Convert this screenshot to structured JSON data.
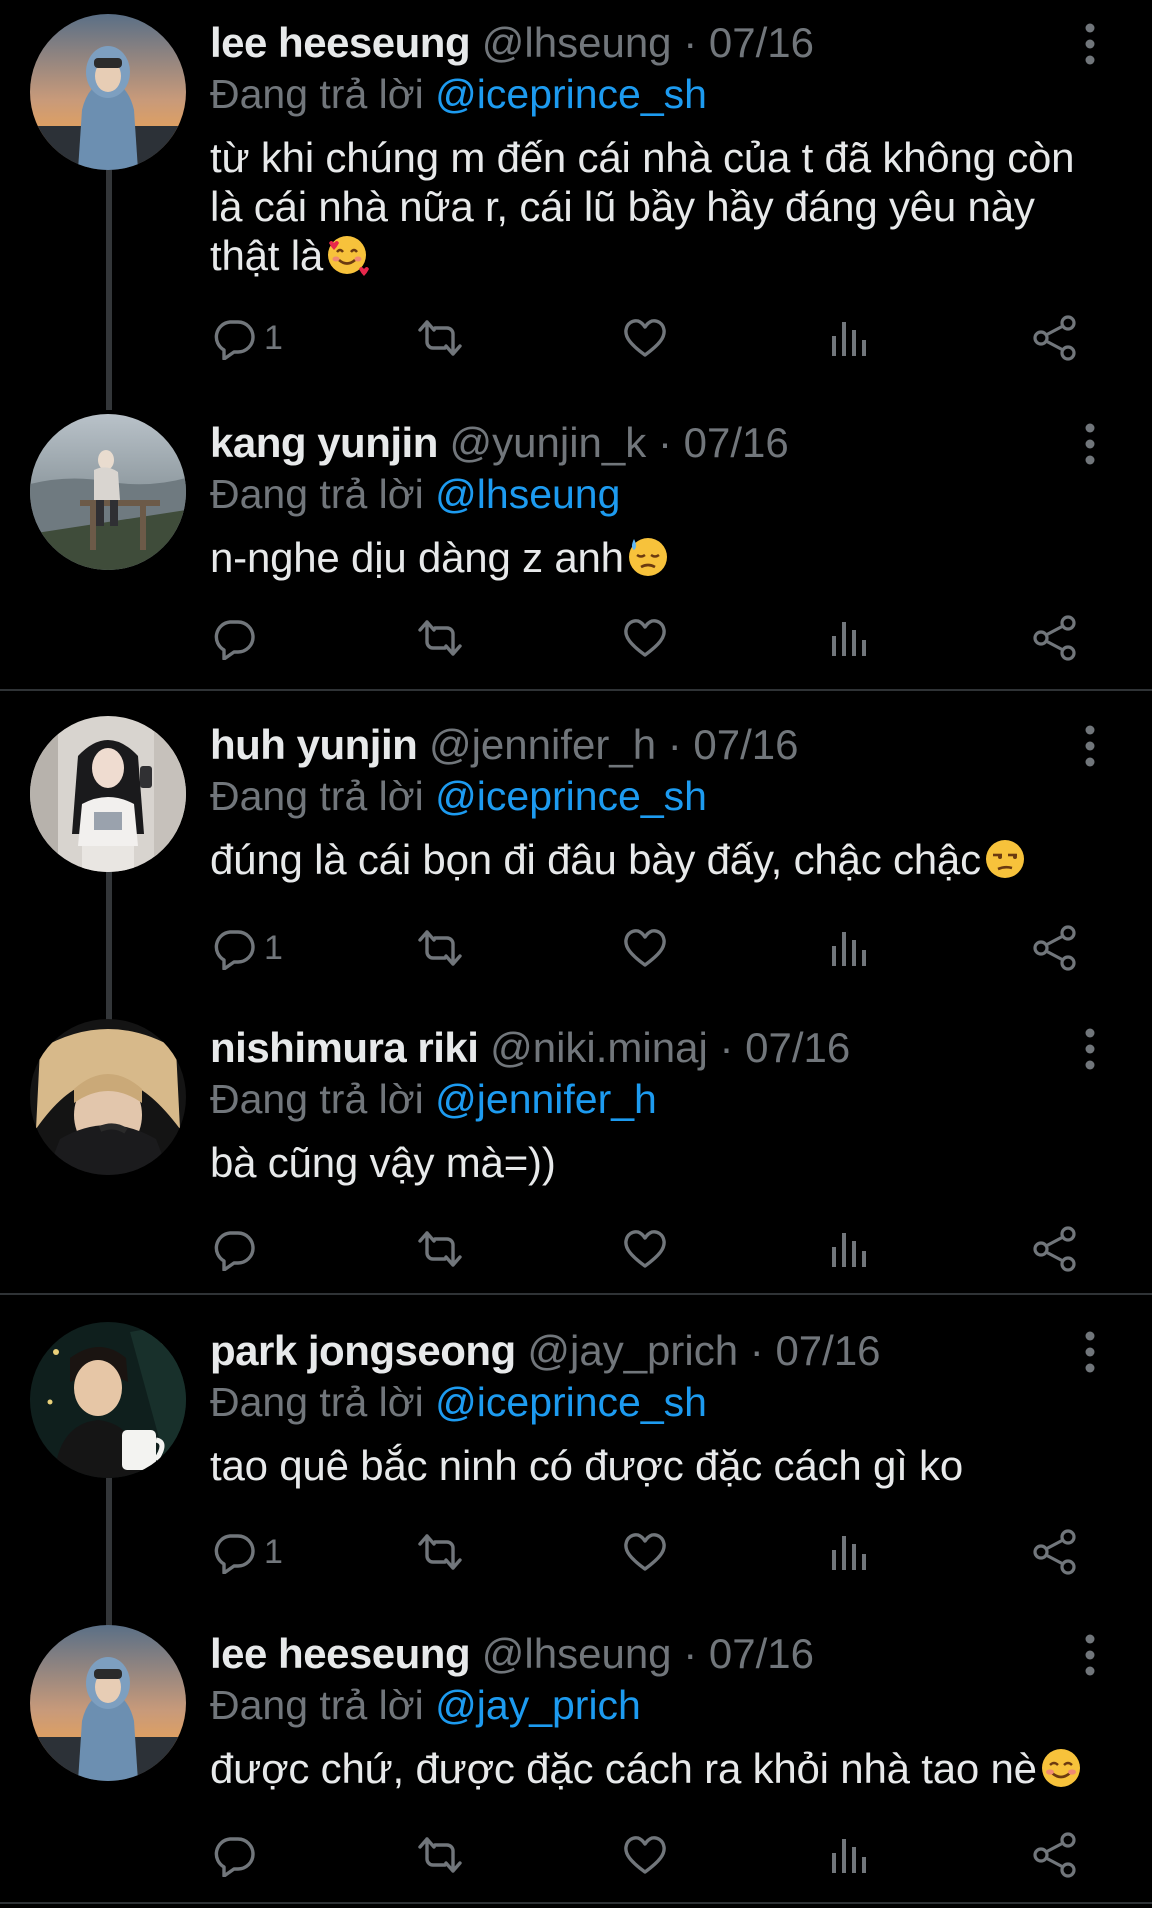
{
  "colors": {
    "background": "#000000",
    "text": "#e7e9ea",
    "muted": "#71767b",
    "mention": "#1d9bf0",
    "thread_line": "#333639",
    "divider": "#2f3336"
  },
  "reply_prefix": "Đang trả lời",
  "tweets": [
    {
      "display_name": "lee heeseung",
      "handle": "@lhseung",
      "dot": "·",
      "date": "07/16",
      "reply_to": "@iceprince_sh",
      "text": "từ khi chúng m đến cái nhà của t đã không còn là cái nhà nữa r, cái lũ bầy hầy đáng yêu này thật là",
      "emoji": "smiling-face-with-hearts",
      "reply_count": "1",
      "avatar": "hooded-person-blue-hoodie"
    },
    {
      "display_name": "kang yunjin",
      "handle": "@yunjin_k",
      "dot": "·",
      "date": "07/16",
      "reply_to": "@lhseung",
      "text": "n-nghe dịu dàng z anh",
      "emoji": "downcast-face-with-sweat",
      "reply_count": "",
      "avatar": "person-on-fence-by-sea"
    },
    {
      "display_name": "huh yunjin",
      "handle": "@jennifer_h",
      "dot": "·",
      "date": "07/16",
      "reply_to": "@iceprince_sh",
      "text": "đúng là cái bọn đi đâu bày đấy, chậc chậc",
      "emoji": "unamused-face",
      "reply_count": "1",
      "avatar": "mirror-selfie"
    },
    {
      "display_name": "nishimura riki",
      "handle": "@niki.minaj",
      "dot": "·",
      "date": "07/16",
      "reply_to": "@jennifer_h",
      "text": "bà cũng vậy mà=))",
      "emoji": "",
      "reply_count": "",
      "avatar": "blond-hair-closeup"
    },
    {
      "display_name": "park jongseong",
      "handle": "@jay_prich",
      "dot": "·",
      "date": "07/16",
      "reply_to": "@iceprince_sh",
      "text": "tao quê bắc ninh có được đặc cách gì ko",
      "emoji": "",
      "reply_count": "1",
      "avatar": "person-with-mug"
    },
    {
      "display_name": "lee heeseung",
      "handle": "@lhseung",
      "dot": "·",
      "date": "07/16",
      "reply_to": "@jay_prich",
      "text": "được chứ, được đặc cách ra khỏi nhà tao nè",
      "emoji": "smiling-face",
      "reply_count": "",
      "avatar": "hooded-person-blue-hoodie"
    }
  ],
  "icons": {
    "reply": "reply-bubble-icon",
    "retweet": "retweet-icon",
    "like": "heart-icon",
    "views": "views-bar-chart-icon",
    "share": "share-icon",
    "more": "more-vertical-icon"
  }
}
